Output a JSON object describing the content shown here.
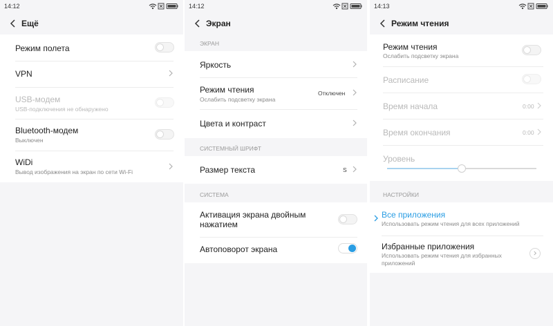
{
  "screens": [
    {
      "time": "14:12",
      "title": "Ещё",
      "items": [
        {
          "label": "Режим полета"
        },
        {
          "label": "VPN"
        },
        {
          "label": "USB-модем",
          "sub": "USB-подключения не обнаружено"
        },
        {
          "label": "Bluetooth-модем",
          "sub": "Выключен"
        },
        {
          "label": "WiDi",
          "sub": "Вывод изображения на экран по сети Wi-Fi"
        }
      ]
    },
    {
      "time": "14:12",
      "title": "Экран",
      "sections": [
        {
          "header": "ЭКРАН",
          "items": [
            {
              "label": "Яркость"
            },
            {
              "label": "Режим чтения",
              "sub": "Ослабить подсветку экрана",
              "value": "Отключен"
            },
            {
              "label": "Цвета и контраст"
            }
          ]
        },
        {
          "header": "СИСТЕМНЫЙ ШРИФТ",
          "items": [
            {
              "label": "Размер текста",
              "value": "S"
            }
          ]
        },
        {
          "header": "СИСТЕМА",
          "items": [
            {
              "label_line1": "Активация экрана двойным",
              "label_line2": "нажатием"
            },
            {
              "label": "Автоповорот экрана"
            }
          ]
        }
      ]
    },
    {
      "time": "14:13",
      "title": "Режим чтения",
      "items": [
        {
          "label": "Режим чтения",
          "sub": "Ослабить подсветку экрана"
        },
        {
          "label": "Расписание"
        },
        {
          "label": "Время начала",
          "value": "0:00"
        },
        {
          "label": "Время окончания",
          "value": "0:00"
        },
        {
          "label": "Уровень",
          "level": 0.5
        }
      ],
      "settings_header": "НАСТРОЙКИ",
      "settings": [
        {
          "label": "Все приложения",
          "sub": "Использовать режим чтения для всех приложений"
        },
        {
          "label": "Избранные приложения",
          "sub_line1": "Использовать режим чтения для избранных",
          "sub_line2": "приложений"
        }
      ]
    }
  ],
  "toggles": {
    "airplane_mode": false,
    "usb_modem": false,
    "bluetooth_modem": false,
    "double_tap_wake": false,
    "auto_rotate": true,
    "reading_mode": false,
    "schedule": false
  },
  "colors": {
    "accent": "#2a9de3",
    "background": "#f5f5f7",
    "card": "#ffffff",
    "disabled_text": "#b9b9b9"
  },
  "icons": [
    "wifi-icon",
    "sim-icon",
    "battery-icon",
    "back-arrow-icon",
    "chevron-right-icon"
  ]
}
